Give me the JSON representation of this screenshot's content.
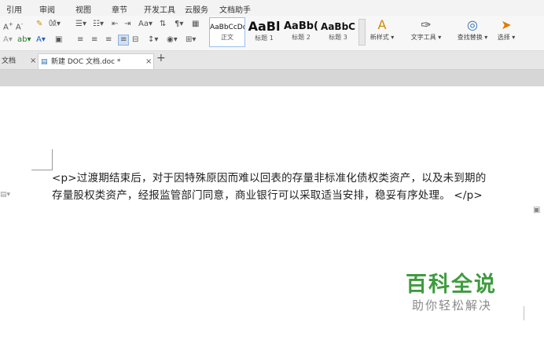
{
  "menu": {
    "items": [
      "引用",
      "审阅",
      "视图",
      "章节",
      "开发工具",
      "云服务",
      "文档助手"
    ]
  },
  "ribbon": {
    "styles": [
      {
        "sample": "AaBbCcDd",
        "name": "正文"
      },
      {
        "sample": "AaBl",
        "name": "标题 1"
      },
      {
        "sample": "AaBb(",
        "name": "标题 2"
      },
      {
        "sample": "AaBbC",
        "name": "标题 3"
      }
    ],
    "new_style_label": "新样式",
    "text_tools_label": "文字工具",
    "find_replace_label": "查找替换",
    "select_label": "选择"
  },
  "tabs": {
    "first_label": "文档",
    "active_label": "新建 DOC 文档.doc *",
    "new_tab_symbol": "+"
  },
  "document": {
    "lines": [
      "<p>过渡期结束后，对于因特殊原因而难以回表的存量非标准化债权类资产，以及未到期的",
      "存量股权类资产，经报监管部门同意，商业银行可以采取适当安排，稳妥有序处理。 </p>"
    ]
  },
  "watermark": {
    "title": "百科全说",
    "subtitle": "助你轻松解决"
  }
}
